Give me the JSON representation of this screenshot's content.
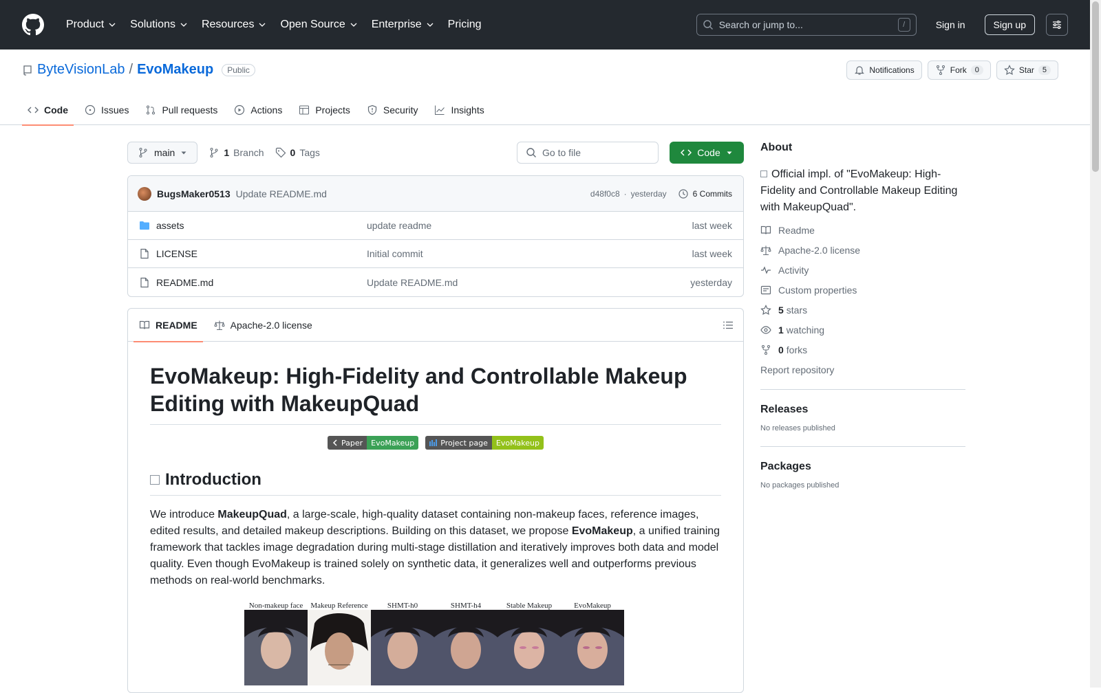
{
  "header": {
    "nav": [
      {
        "label": "Product",
        "dropdown": true
      },
      {
        "label": "Solutions",
        "dropdown": true
      },
      {
        "label": "Resources",
        "dropdown": true
      },
      {
        "label": "Open Source",
        "dropdown": true
      },
      {
        "label": "Enterprise",
        "dropdown": true
      },
      {
        "label": "Pricing",
        "dropdown": false
      }
    ],
    "search_placeholder": "Search or jump to...",
    "search_shortcut": "/",
    "sign_in": "Sign in",
    "sign_up": "Sign up"
  },
  "repo": {
    "owner": "ByteVisionLab",
    "separator": "/",
    "name": "EvoMakeup",
    "visibility": "Public",
    "notifications": "Notifications",
    "fork_label": "Fork",
    "fork_count": "0",
    "star_label": "Star",
    "star_count": "5",
    "tabs": [
      {
        "label": "Code",
        "icon": "code-icon"
      },
      {
        "label": "Issues",
        "icon": "issue-icon"
      },
      {
        "label": "Pull requests",
        "icon": "pull-request-icon"
      },
      {
        "label": "Actions",
        "icon": "play-icon"
      },
      {
        "label": "Projects",
        "icon": "table-icon"
      },
      {
        "label": "Security",
        "icon": "shield-icon"
      },
      {
        "label": "Insights",
        "icon": "graph-icon"
      }
    ]
  },
  "filenav": {
    "branch": "main",
    "branch_count": "1",
    "branch_word": "Branch",
    "tag_count": "0",
    "tag_word": "Tags",
    "goto_placeholder": "Go to file",
    "code_button": "Code"
  },
  "commit": {
    "author": "BugsMaker0513",
    "message": "Update README.md",
    "hash": "d48f0c8",
    "dot": "·",
    "time": "yesterday",
    "commits": "6 Commits"
  },
  "files": [
    {
      "type": "folder",
      "name": "assets",
      "message": "update readme",
      "date": "last week"
    },
    {
      "type": "file",
      "name": "LICENSE",
      "message": "Initial commit",
      "date": "last week"
    },
    {
      "type": "file",
      "name": "README.md",
      "message": "Update README.md",
      "date": "yesterday"
    }
  ],
  "readme": {
    "tab_readme": "README",
    "tab_license": "Apache-2.0 license",
    "title": "EvoMakeup: High-Fidelity and Controllable Makeup Editing with MakeupQuad",
    "badges": [
      {
        "left": "Paper",
        "right": "EvoMakeup",
        "color": "#3ba156"
      },
      {
        "left": "Project page",
        "right": "EvoMakeup",
        "color": "#93c11a"
      }
    ],
    "intro_heading": "Introduction",
    "p1": "We introduce ",
    "b1": "MakeupQuad",
    "p2": ", a large-scale, high-quality dataset containing non-makeup faces, reference images, edited results, and detailed makeup descriptions. Building on this dataset, we propose ",
    "b2": "EvoMakeup",
    "p3": ", a unified training framework that tackles image degradation during multi-stage distillation and iteratively improves both data and model quality. Even though EvoMakeup is trained solely on synthetic data, it generalizes well and outperforms previous methods on real-world benchmarks.",
    "figure_labels": [
      "Non-makeup face",
      "Makeup Reference",
      "SHMT-h0",
      "SHMT-h4",
      "Stable Makeup",
      "EvoMakeup"
    ]
  },
  "sidebar": {
    "about": "About",
    "description": "Official impl. of \"EvoMakeup: High-Fidelity and Controllable Makeup Editing with MakeupQuad\".",
    "readme": "Readme",
    "license": "Apache-2.0 license",
    "activity": "Activity",
    "custom_props": "Custom properties",
    "stars_count": "5",
    "stars_word": "stars",
    "watching_count": "1",
    "watching_word": "watching",
    "forks_count": "0",
    "forks_word": "forks",
    "report": "Report repository",
    "releases": "Releases",
    "releases_empty": "No releases published",
    "packages": "Packages",
    "packages_empty": "No packages published"
  },
  "colors": {
    "header_bg": "#24292f",
    "link": "#0969da",
    "code_button": "#1f883d",
    "tab_underline": "#fd8c73"
  }
}
